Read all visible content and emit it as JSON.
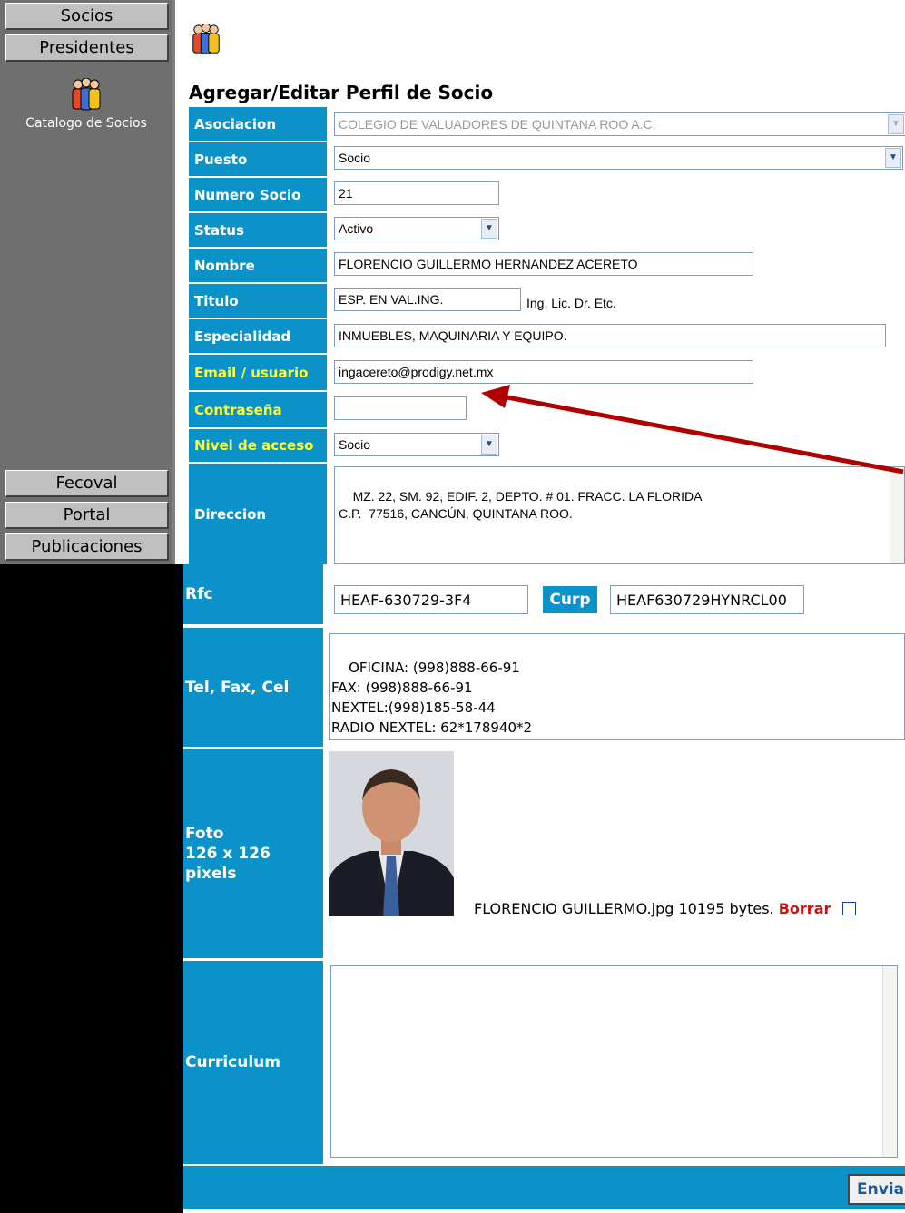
{
  "sidebar": {
    "top_buttons": [
      "Socios",
      "Presidentes"
    ],
    "catalog_link": "Catalogo de Socios",
    "bottom_buttons": [
      "Fecoval",
      "Portal",
      "Publicaciones"
    ]
  },
  "form": {
    "title": "Agregar/Editar Perfil de Socio",
    "asociacion": {
      "label": "Asociacion",
      "value": "COLEGIO DE VALUADORES DE QUINTANA ROO A.C."
    },
    "puesto": {
      "label": "Puesto",
      "value": "Socio"
    },
    "numero_socio": {
      "label": "Numero Socio",
      "value": "21"
    },
    "status": {
      "label": "Status",
      "value": "Activo"
    },
    "nombre": {
      "label": "Nombre",
      "value": "FLORENCIO GUILLERMO HERNANDEZ ACERETO"
    },
    "titulo": {
      "label": "Titulo",
      "value": "ESP. EN VAL.ING.",
      "hint": "Ing, Lic. Dr. Etc."
    },
    "especialidad": {
      "label": "Especialidad",
      "value": "INMUEBLES, MAQUINARIA Y EQUIPO."
    },
    "email": {
      "label": "Email / usuario",
      "value": "ingacereto@prodigy.net.mx"
    },
    "contrasena": {
      "label": "Contraseña",
      "value": ""
    },
    "nivel_acceso": {
      "label": "Nivel de acceso",
      "value": "Socio"
    },
    "direccion": {
      "label": "Direccion",
      "value": "MZ. 22, SM. 92, EDIF. 2, DEPTO. # 01. FRACC. LA FLORIDA\nC.P.  77516, CANCÚN, QUINTANA ROO."
    },
    "rfc": {
      "label": "Rfc",
      "value": "HEAF-630729-3F4"
    },
    "curp": {
      "label": "Curp",
      "value": "HEAF630729HYNRCL00"
    },
    "tel": {
      "label": "Tel, Fax, Cel",
      "value": "OFICINA: (998)888-66-91\nFAX: (998)888-66-91\nNEXTEL:(998)185-58-44\nRADIO NEXTEL: 62*178940*2"
    },
    "foto": {
      "label": "Foto\n126 x 126\npixels",
      "file_text": "FLORENCIO GUILLERMO.jpg 10195 bytes.",
      "delete_label": "Borrar"
    },
    "curriculum": {
      "label": "Curriculum",
      "value": ""
    },
    "submit_label": "Envia"
  },
  "colors": {
    "label_bg": "#0b93c9",
    "highlight_label": "#ffff33",
    "annotation_arrow": "#b00000"
  },
  "icons": [
    "users-icon",
    "chevron-down-icon",
    "checkbox-icon",
    "annotation-arrow"
  ]
}
